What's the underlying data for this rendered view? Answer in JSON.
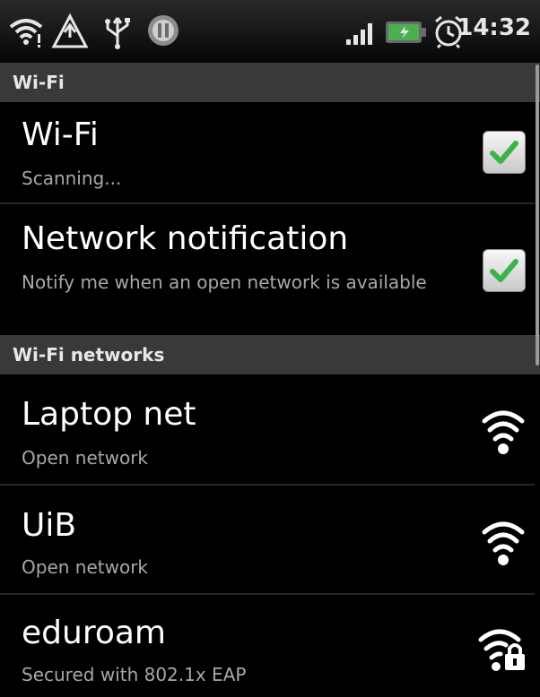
{
  "status_bar": {
    "time": "14:32",
    "icons": [
      "wifi-signal-icon",
      "warning-icon",
      "usb-icon",
      "pause-icon",
      "cell-signal-icon",
      "battery-icon",
      "alarm-icon"
    ],
    "battery_color": "#4caf50"
  },
  "sections": {
    "wifi": {
      "label": "Wi-Fi"
    },
    "networks": {
      "label": "Wi-Fi networks"
    }
  },
  "settings": {
    "wifi": {
      "title": "Wi-Fi",
      "summary": "Scanning...",
      "checked": true
    },
    "network_notification": {
      "title": "Network notification",
      "summary": "Notify me when an open network is available",
      "checked": true
    }
  },
  "networks": [
    {
      "name": "Laptop net",
      "security": "Open network",
      "icon": "wifi-open-icon"
    },
    {
      "name": "UiB",
      "security": "Open network",
      "icon": "wifi-open-icon"
    },
    {
      "name": "eduroam",
      "security": "Secured with 802.1x EAP",
      "icon": "wifi-locked-icon"
    }
  ],
  "colors": {
    "check_green": "#3cb34a",
    "header_bg": "#393939"
  }
}
